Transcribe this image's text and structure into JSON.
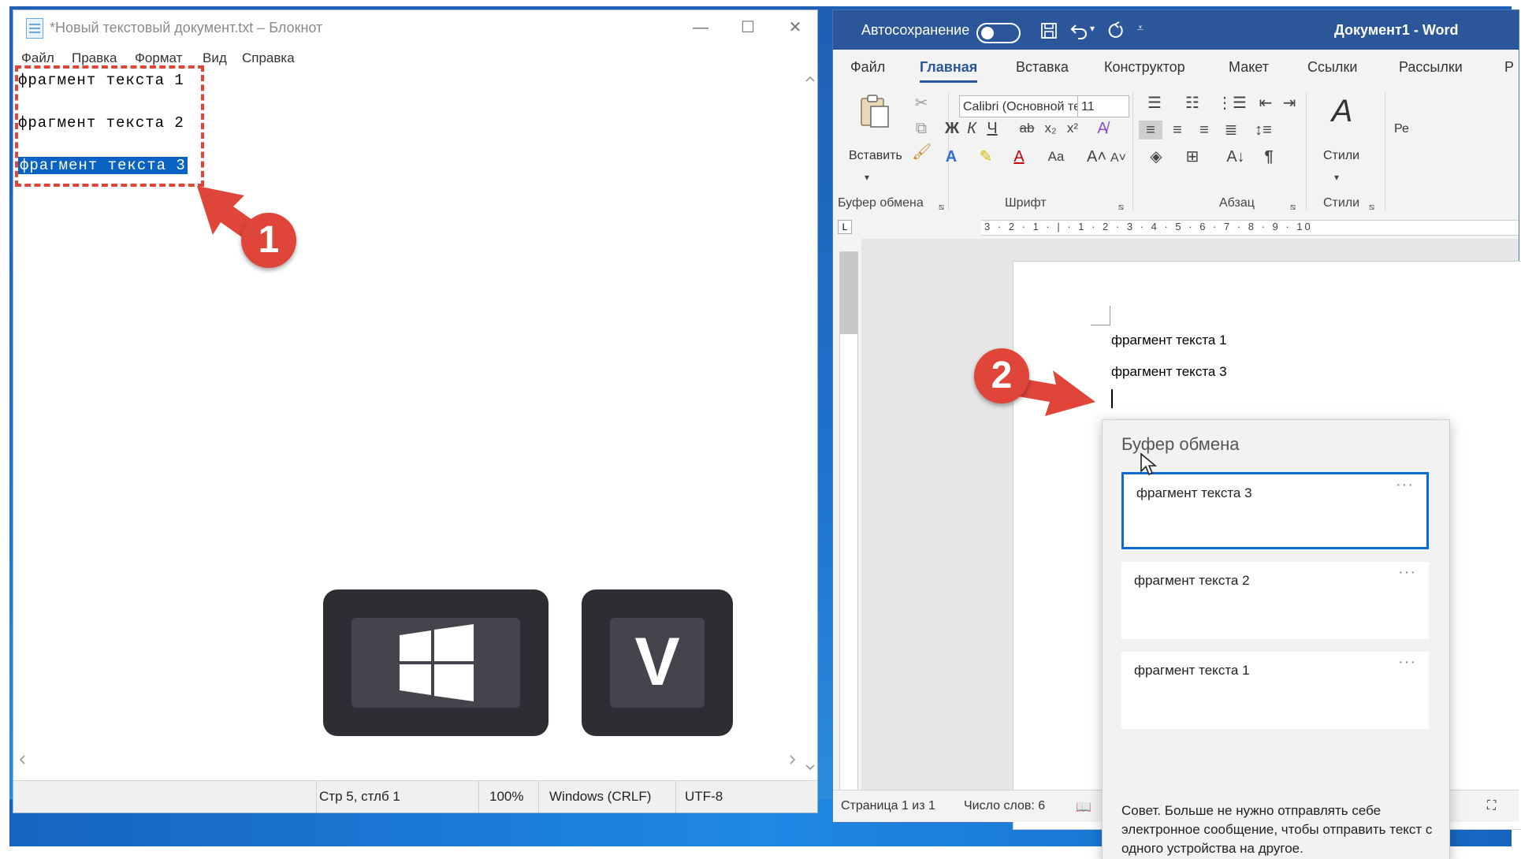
{
  "notepad": {
    "title": "*Новый текстовый документ.txt – Блокнот",
    "menu": [
      "Файл",
      "Правка",
      "Формат",
      "Вид",
      "Справка"
    ],
    "lines": [
      "фрагмент текста 1",
      "фрагмент текста 2",
      "фрагмент текста 3"
    ],
    "status": {
      "position": "Стр 5, стлб 1",
      "zoom": "100%",
      "line_endings": "Windows (CRLF)",
      "encoding": "UTF-8"
    }
  },
  "word": {
    "autosave_label": "Автосохранение",
    "doc_title": "Документ1 - Word",
    "tabs": [
      "Файл",
      "Главная",
      "Вставка",
      "Конструктор",
      "Макет",
      "Ссылки",
      "Рассылки",
      "Р"
    ],
    "active_tab": "Главная",
    "ribbon": {
      "paste_label": "Вставить",
      "font_name": "Calibri (Основной текст)",
      "font_size": "11",
      "bold": "Ж",
      "italic": "К",
      "underline": "Ч",
      "styles_label": "Стили",
      "edit_label": "Ре",
      "groups": {
        "clipboard": "Буфер обмена",
        "font": "Шрифт",
        "paragraph": "Абзац",
        "styles": "Стили"
      }
    },
    "ruler_text": "3 · 2 · 1 · | · 1 · 2 · 3 · 4 · 5 · 6 · 7 · 8 · 9 · 10",
    "doc_lines": [
      "фрагмент текста 1",
      "фрагмент текста 3"
    ],
    "status": {
      "page": "Страница 1 из 1",
      "words": "Число слов: 6"
    }
  },
  "clipboard_panel": {
    "title": "Буфер обмена",
    "items": [
      "фрагмент текста 3",
      "фрагмент текста 2",
      "фрагмент текста 1"
    ],
    "more": "···",
    "tip": "Совет. Больше не нужно отправлять себе электронное сообщение, чтобы отправить текст с одного устройства на другое."
  },
  "shortcut": {
    "key2": "V"
  },
  "badges": [
    "1",
    "2"
  ],
  "colors": {
    "accent_red": "#e0453a",
    "word_blue": "#2b579a",
    "selection_blue": "#0a62c2"
  }
}
